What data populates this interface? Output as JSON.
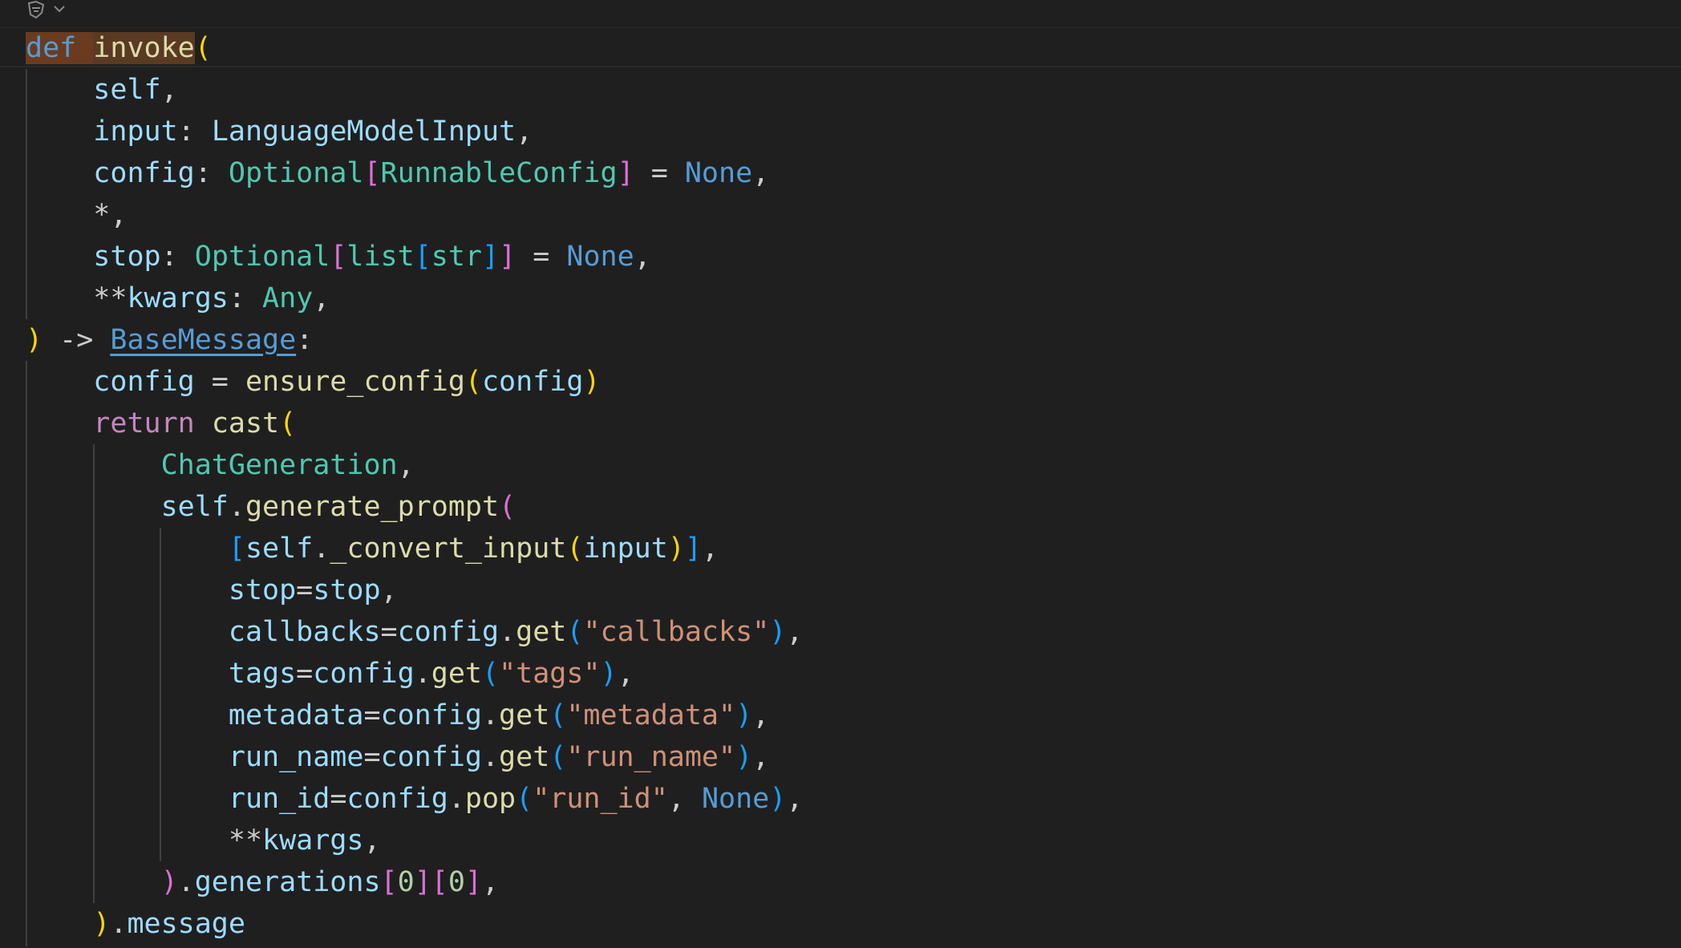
{
  "editor": {
    "language": "python",
    "icons": {
      "sticky": "sticky-scroll-icon",
      "chevron": "chevron-down-icon"
    }
  },
  "code": {
    "l1": {
      "kw": "def",
      "sp": " ",
      "name": "invoke",
      "open": "("
    },
    "l2": {
      "indent": "    ",
      "self": "self",
      "comma": ","
    },
    "l3": {
      "indent": "    ",
      "p": "input",
      "colon": ": ",
      "type": "LanguageModelInput",
      "comma": ","
    },
    "l4": {
      "indent": "    ",
      "p": "config",
      "colon": ": ",
      "t1": "Optional",
      "lb": "[",
      "t2": "RunnableConfig",
      "rb": "]",
      "eq": " = ",
      "none": "None",
      "comma": ","
    },
    "l5": {
      "indent": "    ",
      "star": "*,"
    },
    "l6": {
      "indent": "    ",
      "p": "stop",
      "colon": ": ",
      "t1": "Optional",
      "lb": "[",
      "t2": "list",
      "lb2": "[",
      "t3": "str",
      "rb2": "]",
      "rb": "]",
      "eq": " = ",
      "none": "None",
      "comma": ","
    },
    "l7": {
      "indent": "    ",
      "stars": "**",
      "p": "kwargs",
      "colon": ": ",
      "type": "Any",
      "comma": ","
    },
    "l8": {
      "close": ")",
      "arrow": " -> ",
      "ret": "BaseMessage",
      "colon": ":"
    },
    "l9": {
      "indent": "    ",
      "v": "config",
      "eq": " = ",
      "fn": "ensure_config",
      "open": "(",
      "arg": "config",
      "close": ")"
    },
    "l10": {
      "indent": "    ",
      "kw": "return",
      "sp": " ",
      "fn": "cast",
      "open": "("
    },
    "l11": {
      "indent": "        ",
      "type": "ChatGeneration",
      "comma": ","
    },
    "l12": {
      "indent": "        ",
      "self": "self",
      "dot": ".",
      "fn": "generate_prompt",
      "open": "("
    },
    "l13": {
      "indent": "            ",
      "lb": "[",
      "self": "self",
      "dot": ".",
      "fn": "_convert_input",
      "open": "(",
      "arg": "input",
      "close": ")",
      "rb": "]",
      "comma": ","
    },
    "l14": {
      "indent": "            ",
      "p": "stop",
      "eq": "=",
      "v": "stop",
      "comma": ","
    },
    "l15": {
      "indent": "            ",
      "p": "callbacks",
      "eq": "=",
      "obj": "config",
      "dot": ".",
      "fn": "get",
      "open": "(",
      "s": "\"callbacks\"",
      "close": ")",
      "comma": ","
    },
    "l16": {
      "indent": "            ",
      "p": "tags",
      "eq": "=",
      "obj": "config",
      "dot": ".",
      "fn": "get",
      "open": "(",
      "s": "\"tags\"",
      "close": ")",
      "comma": ","
    },
    "l17": {
      "indent": "            ",
      "p": "metadata",
      "eq": "=",
      "obj": "config",
      "dot": ".",
      "fn": "get",
      "open": "(",
      "s": "\"metadata\"",
      "close": ")",
      "comma": ","
    },
    "l18": {
      "indent": "            ",
      "p": "run_name",
      "eq": "=",
      "obj": "config",
      "dot": ".",
      "fn": "get",
      "open": "(",
      "s": "\"run_name\"",
      "close": ")",
      "comma": ","
    },
    "l19": {
      "indent": "            ",
      "p": "run_id",
      "eq": "=",
      "obj": "config",
      "dot": ".",
      "fn": "pop",
      "open": "(",
      "s": "\"run_id\"",
      "sep": ", ",
      "none": "None",
      "close": ")",
      "comma": ","
    },
    "l20": {
      "indent": "            ",
      "stars": "**",
      "p": "kwargs",
      "comma": ","
    },
    "l21": {
      "indent": "        ",
      "close": ")",
      "dot": ".",
      "attr": "generations",
      "lb1": "[",
      "n1": "0",
      "rb1": "]",
      "lb2": "[",
      "n2": "0",
      "rb2": "]",
      "comma": ","
    },
    "l22": {
      "indent": "    ",
      "close": ")",
      "dot": ".",
      "attr": "message"
    }
  }
}
